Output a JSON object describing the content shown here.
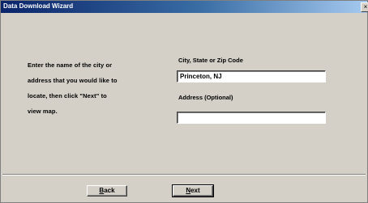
{
  "window": {
    "title": "Data Download Wizard",
    "close_glyph": "×"
  },
  "instructions": {
    "lines": [
      "Enter the name of the city or",
      "address that you would like to",
      "locate, then click \"Next\" to",
      "view map."
    ]
  },
  "city_field": {
    "label": "City, State or Zip Code",
    "value": "Princeton, NJ"
  },
  "address_field": {
    "label": "Address (Optional)",
    "value": ""
  },
  "buttons": {
    "back": {
      "accel": "B",
      "rest": "ack"
    },
    "next": {
      "accel": "N",
      "rest": "ext"
    }
  }
}
